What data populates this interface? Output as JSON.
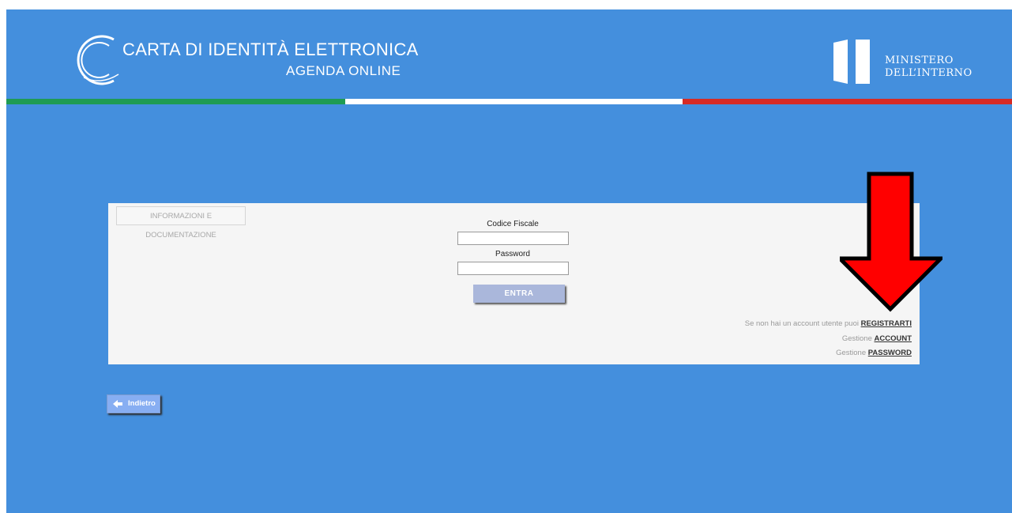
{
  "header": {
    "title_line1": "CARTA DI IDENTITÀ ELETTRONICA",
    "title_line2": "AGENDA ONLINE",
    "ministry_line1": "MINISTERO",
    "ministry_line2": "DELL’INTERNO"
  },
  "flag_colors": {
    "green": "#1f9b53",
    "white": "#ffffff",
    "red": "#d62b25"
  },
  "login": {
    "info_button": "INFORMAZIONI E DOCUMENTAZIONE",
    "codice_fiscale_label": "Codice Fiscale",
    "codice_fiscale_value": "",
    "password_label": "Password",
    "password_value": "",
    "submit_label": "ENTRA",
    "register_text": "Se non hai un account utente puoi",
    "register_link": "REGISTRARTI",
    "account_text": "Gestione",
    "account_link": "ACCOUNT",
    "password_text": "Gestione",
    "password_link": "PASSWORD"
  },
  "back_button": {
    "label": "Indietro",
    "icon": "arrow-left-icon"
  },
  "colors": {
    "background": "#448fdd",
    "panel": "#f5f5f5",
    "submit_button": "#aab7db",
    "annotation_arrow": "#ff0000"
  }
}
